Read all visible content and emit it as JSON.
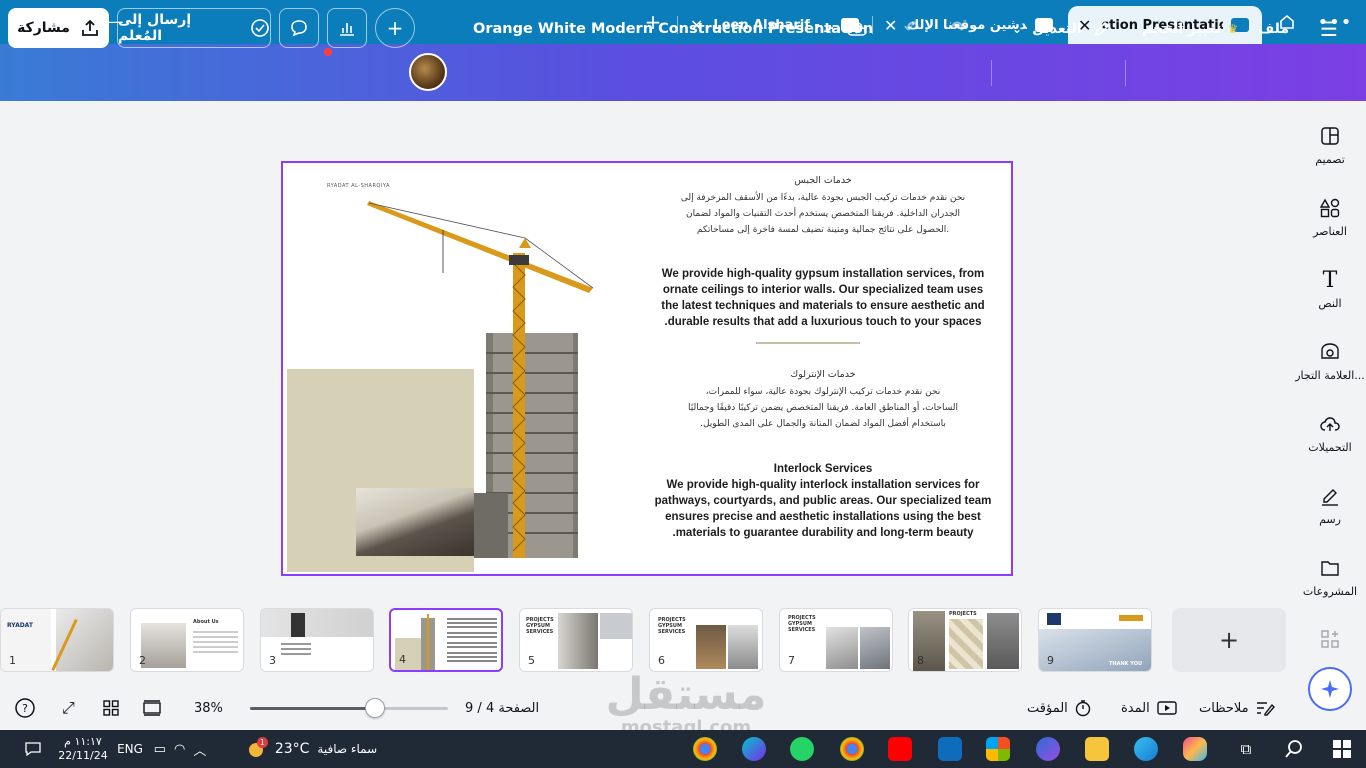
{
  "browser": {
    "tabs": [
      {
        "title": "ction Presentation",
        "active": true
      },
      {
        "title": "تم تدشين موقعنا الإلك...",
        "active": false
      },
      {
        "title": "Leen Alsharif - عر...",
        "active": false
      }
    ],
    "new_tab_label": "+"
  },
  "toolbar": {
    "menu_label": "ملف",
    "resize_label": "تغيير الحجم",
    "edit_label": "التعديل",
    "doc_title": "Orange White Modern Construction Presentation",
    "send_teacher_label": "إرسال إلى المُعلم",
    "share_label": "مشاركة"
  },
  "rail": [
    {
      "label": "تصميم",
      "icon": "design-icon"
    },
    {
      "label": "العناصر",
      "icon": "elements-icon"
    },
    {
      "label": "النص",
      "icon": "text-icon"
    },
    {
      "label": "العلامة التجار...",
      "icon": "brand-icon"
    },
    {
      "label": "التحميلات",
      "icon": "upload-icon"
    },
    {
      "label": "رسم",
      "icon": "draw-icon"
    },
    {
      "label": "المشروعات",
      "icon": "projects-icon"
    }
  ],
  "slide": {
    "brand_text": "RYADAT AL-SHARQIYA",
    "gypsum_title_ar": "خدمات الجبس",
    "gypsum_body_ar": [
      "نحن نقدم خدمات تركيب الجبس بجودة عالية، بدءًا من الأسقف المزخرفة إلى",
      "الجدران الداخلية. فريقنا المتخصص يستخدم أحدث التقنيات والمواد لضمان",
      ".الحصول على نتائج جمالية ومتينة تضيف لمسة فاخرة إلى مساحاتكم"
    ],
    "gypsum_body_en": [
      "We provide high-quality gypsum installation services, from",
      "ornate ceilings to interior walls. Our specialized team uses",
      "the latest techniques and materials to ensure aesthetic and",
      ".durable results that add a luxurious touch to your spaces"
    ],
    "interlock_title_ar": "خدمات الإنترلوك",
    "interlock_body_ar": [
      "نحن نقدم خدمات تركيب الإنترلوك بجودة عالية، سواء للممرات،",
      "الساحات، أو المناطق العامة. فريقنا المتخصص يضمن تركيبًا دقيقًا وجماليًا",
      "باستخدام أفضل المواد لضمان المتانة والجمال على المدى الطويل."
    ],
    "interlock_title_en": "Interlock Services",
    "interlock_body_en": [
      "We provide high-quality interlock installation services for",
      "pathways, courtyards, and public areas. Our specialized team",
      "ensures precise and aesthetic installations using the best",
      ".materials to guarantee durability and long-term beauty"
    ]
  },
  "thumbnails": [
    {
      "num": "1",
      "label": "RYADAT"
    },
    {
      "num": "2",
      "label": "About Us"
    },
    {
      "num": "3",
      "label": ""
    },
    {
      "num": "4",
      "label": ""
    },
    {
      "num": "5",
      "label": "PROJECTS GYPSUM SERVICES"
    },
    {
      "num": "6",
      "label": "PROJECTS GYPSUM SERVICES"
    },
    {
      "num": "7",
      "label": "PROJECTS GYPSUM SERVICES"
    },
    {
      "num": "8",
      "label": "PROJECTS"
    },
    {
      "num": "9",
      "label": "THANK YOU"
    }
  ],
  "bottom": {
    "notes_label": "ملاحظات",
    "duration_label": "المدة",
    "timer_label": "المؤقت",
    "page_label": "الصفحة 4 / 9",
    "zoom_label": "38%",
    "zoom_fraction": 0.38
  },
  "taskbar": {
    "weather_text": "سماء صافية",
    "temperature": "23°C",
    "weather_badge": "1",
    "language": "ENG",
    "time": "١١:١٧ م",
    "date": "22/11/24"
  },
  "watermark": {
    "title": "مستقل",
    "sub": "mostaql.com"
  },
  "colors": {
    "accent": "#8b3dff",
    "titlebar": "#0b7dba",
    "toolbar_start": "#3a7bd5",
    "toolbar_end": "#7b3fe4"
  }
}
